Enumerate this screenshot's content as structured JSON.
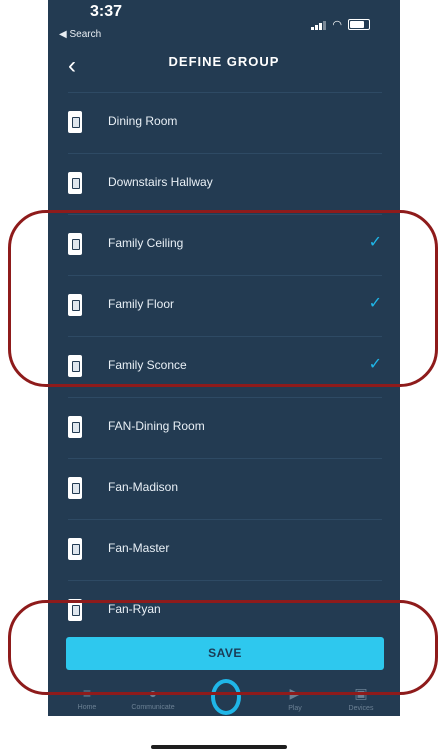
{
  "status": {
    "time": "3:37",
    "back_app": "◀ Search"
  },
  "header": {
    "title": "DEFINE GROUP",
    "back_icon": "chevron-left-icon"
  },
  "devices": [
    {
      "label": "Dining Room",
      "checked": false
    },
    {
      "label": "Downstairs Hallway",
      "checked": false
    },
    {
      "label": "Family Ceiling",
      "checked": true
    },
    {
      "label": "Family Floor",
      "checked": true
    },
    {
      "label": "Family Sconce",
      "checked": true
    },
    {
      "label": "FAN-Dining Room",
      "checked": false
    },
    {
      "label": "Fan-Madison",
      "checked": false
    },
    {
      "label": "Fan-Master",
      "checked": false
    },
    {
      "label": "Fan-Ryan",
      "checked": false
    }
  ],
  "check_glyph": "✓",
  "save_label": "SAVE",
  "nav": {
    "home": "Home",
    "communicate": "Communicate",
    "play": "Play",
    "devices": "Devices"
  },
  "colors": {
    "background": "#233b52",
    "accent": "#2ec8ee",
    "highlight": "#8e1b1b"
  }
}
